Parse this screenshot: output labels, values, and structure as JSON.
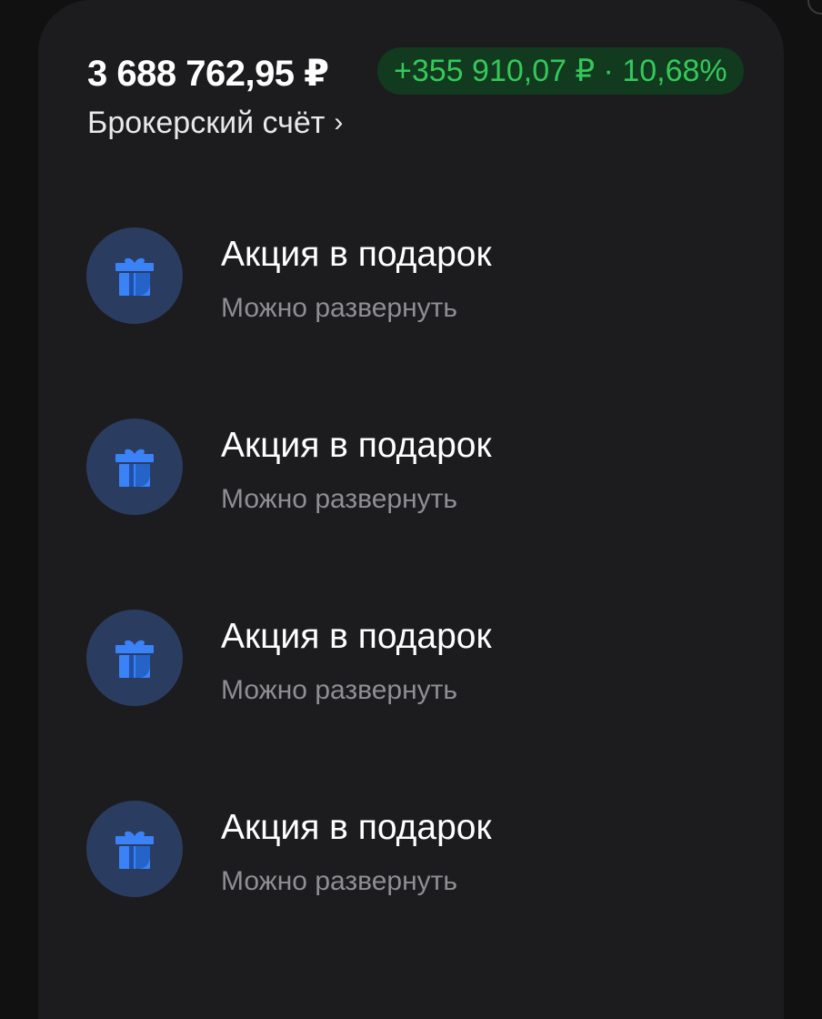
{
  "account": {
    "balance": "3 688 762,95 ₽",
    "profit_badge": "+355 910,07 ₽ · 10,68%",
    "name": "Брокерский счёт",
    "chevron": "›"
  },
  "colors": {
    "card_background": "#1c1c1e",
    "profit_green": "#34c85a",
    "profit_badge_bg": "#123a1f",
    "icon_circle_bg": "#2a3d61",
    "gift_blue": "#3b82f6"
  },
  "items": [
    {
      "title": "Акция в подарок",
      "subtitle": "Можно развернуть",
      "icon": "gift-icon"
    },
    {
      "title": "Акция в подарок",
      "subtitle": "Можно развернуть",
      "icon": "gift-icon"
    },
    {
      "title": "Акция в подарок",
      "subtitle": "Можно развернуть",
      "icon": "gift-icon"
    },
    {
      "title": "Акция в подарок",
      "subtitle": "Можно развернуть",
      "icon": "gift-icon"
    }
  ]
}
